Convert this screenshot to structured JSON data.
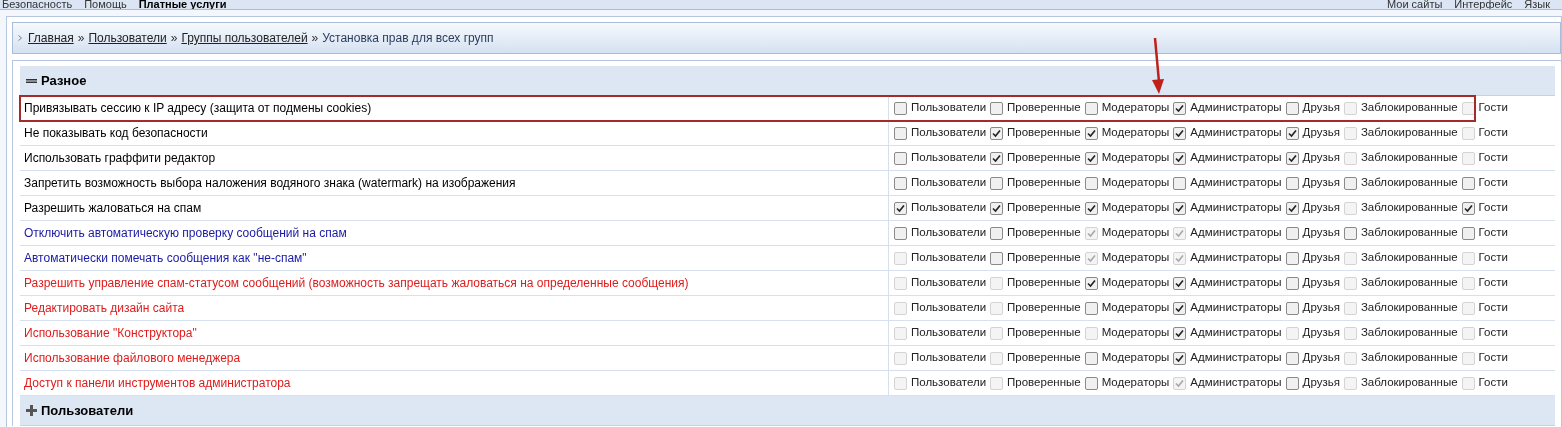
{
  "top_bar": {
    "left": [
      "Безопасность",
      "Помощь",
      "Платные услуги"
    ],
    "right": [
      "Мои сайты",
      "Интерфейс",
      "Язык"
    ]
  },
  "breadcrumbs": [
    {
      "label": "Главная",
      "link": true
    },
    {
      "separator": "»"
    },
    {
      "label": "Пользователи",
      "link": true
    },
    {
      "separator": "»"
    },
    {
      "label": "Группы пользователей",
      "link": true
    },
    {
      "separator": "»"
    },
    {
      "label": "Установка прав для всех групп",
      "link": false
    }
  ],
  "sections": [
    {
      "title": "Разное",
      "expanded": true,
      "rows": [
        {
          "label": "Привязывать сессию к IP адресу (защита от подмены cookies)",
          "color": "#000000",
          "highlighted": true,
          "groups": [
            {
              "label": "Пользователи",
              "checked": false,
              "disabled": false
            },
            {
              "label": "Проверенные",
              "checked": false,
              "disabled": false
            },
            {
              "label": "Модераторы",
              "checked": false,
              "disabled": false
            },
            {
              "label": "Администраторы",
              "checked": true,
              "disabled": false
            },
            {
              "label": "Друзья",
              "checked": false,
              "disabled": false
            },
            {
              "label": "Заблокированные",
              "checked": false,
              "disabled": true
            },
            {
              "label": "Гости",
              "checked": false,
              "disabled": true
            }
          ]
        },
        {
          "label": "Не показывать код безопасности",
          "color": "#000000",
          "highlighted": false,
          "groups": [
            {
              "label": "Пользователи",
              "checked": false,
              "disabled": false
            },
            {
              "label": "Проверенные",
              "checked": true,
              "disabled": false
            },
            {
              "label": "Модераторы",
              "checked": true,
              "disabled": false
            },
            {
              "label": "Администраторы",
              "checked": true,
              "disabled": false
            },
            {
              "label": "Друзья",
              "checked": true,
              "disabled": false
            },
            {
              "label": "Заблокированные",
              "checked": false,
              "disabled": true
            },
            {
              "label": "Гости",
              "checked": false,
              "disabled": true
            }
          ]
        },
        {
          "label": "Использовать граффити редактор",
          "color": "#000000",
          "highlighted": false,
          "groups": [
            {
              "label": "Пользователи",
              "checked": false,
              "disabled": false
            },
            {
              "label": "Проверенные",
              "checked": true,
              "disabled": false
            },
            {
              "label": "Модераторы",
              "checked": true,
              "disabled": false
            },
            {
              "label": "Администраторы",
              "checked": true,
              "disabled": false
            },
            {
              "label": "Друзья",
              "checked": true,
              "disabled": false
            },
            {
              "label": "Заблокированные",
              "checked": false,
              "disabled": true
            },
            {
              "label": "Гости",
              "checked": false,
              "disabled": true
            }
          ]
        },
        {
          "label": "Запретить возможность выбора наложения водяного знака (watermark) на изображения",
          "color": "#000000",
          "highlighted": false,
          "groups": [
            {
              "label": "Пользователи",
              "checked": false,
              "disabled": false
            },
            {
              "label": "Проверенные",
              "checked": false,
              "disabled": false
            },
            {
              "label": "Модераторы",
              "checked": false,
              "disabled": false
            },
            {
              "label": "Администраторы",
              "checked": false,
              "disabled": false
            },
            {
              "label": "Друзья",
              "checked": false,
              "disabled": false
            },
            {
              "label": "Заблокированные",
              "checked": false,
              "disabled": false
            },
            {
              "label": "Гости",
              "checked": false,
              "disabled": false
            }
          ]
        },
        {
          "label": "Разрешить жаловаться на спам",
          "color": "#000000",
          "highlighted": false,
          "groups": [
            {
              "label": "Пользователи",
              "checked": true,
              "disabled": false
            },
            {
              "label": "Проверенные",
              "checked": true,
              "disabled": false
            },
            {
              "label": "Модераторы",
              "checked": true,
              "disabled": false
            },
            {
              "label": "Администраторы",
              "checked": true,
              "disabled": false
            },
            {
              "label": "Друзья",
              "checked": true,
              "disabled": false
            },
            {
              "label": "Заблокированные",
              "checked": false,
              "disabled": true
            },
            {
              "label": "Гости",
              "checked": true,
              "disabled": false
            }
          ]
        },
        {
          "label": "Отключить автоматическую проверку сообщений на спам",
          "color": "#1a1aa6",
          "highlighted": false,
          "groups": [
            {
              "label": "Пользователи",
              "checked": false,
              "disabled": false
            },
            {
              "label": "Проверенные",
              "checked": false,
              "disabled": false
            },
            {
              "label": "Модераторы",
              "checked": true,
              "disabled": true
            },
            {
              "label": "Администраторы",
              "checked": true,
              "disabled": true
            },
            {
              "label": "Друзья",
              "checked": false,
              "disabled": false
            },
            {
              "label": "Заблокированные",
              "checked": false,
              "disabled": false
            },
            {
              "label": "Гости",
              "checked": false,
              "disabled": false
            }
          ]
        },
        {
          "label": "Автоматически помечать сообщения как \"не-спам\"",
          "color": "#1a1aa6",
          "highlighted": false,
          "groups": [
            {
              "label": "Пользователи",
              "checked": false,
              "disabled": true
            },
            {
              "label": "Проверенные",
              "checked": false,
              "disabled": false
            },
            {
              "label": "Модераторы",
              "checked": true,
              "disabled": true
            },
            {
              "label": "Администраторы",
              "checked": true,
              "disabled": true
            },
            {
              "label": "Друзья",
              "checked": false,
              "disabled": false
            },
            {
              "label": "Заблокированные",
              "checked": false,
              "disabled": true
            },
            {
              "label": "Гости",
              "checked": false,
              "disabled": true
            }
          ]
        },
        {
          "label": "Разрешить управление спам-статусом сообщений (возможность запрещать жаловаться на определенные сообщения)",
          "color": "#e01b1b",
          "highlighted": false,
          "groups": [
            {
              "label": "Пользователи",
              "checked": false,
              "disabled": true
            },
            {
              "label": "Проверенные",
              "checked": false,
              "disabled": true
            },
            {
              "label": "Модераторы",
              "checked": true,
              "disabled": false
            },
            {
              "label": "Администраторы",
              "checked": true,
              "disabled": false
            },
            {
              "label": "Друзья",
              "checked": false,
              "disabled": false
            },
            {
              "label": "Заблокированные",
              "checked": false,
              "disabled": true
            },
            {
              "label": "Гости",
              "checked": false,
              "disabled": true
            }
          ]
        },
        {
          "label": "Редактировать дизайн сайта",
          "color": "#e01b1b",
          "highlighted": false,
          "groups": [
            {
              "label": "Пользователи",
              "checked": false,
              "disabled": true
            },
            {
              "label": "Проверенные",
              "checked": false,
              "disabled": true
            },
            {
              "label": "Модераторы",
              "checked": false,
              "disabled": false
            },
            {
              "label": "Администраторы",
              "checked": true,
              "disabled": false
            },
            {
              "label": "Друзья",
              "checked": false,
              "disabled": false
            },
            {
              "label": "Заблокированные",
              "checked": false,
              "disabled": true
            },
            {
              "label": "Гости",
              "checked": false,
              "disabled": true
            }
          ]
        },
        {
          "label": "Использование \"Конструктора\"",
          "color": "#e01b1b",
          "highlighted": false,
          "groups": [
            {
              "label": "Пользователи",
              "checked": false,
              "disabled": true
            },
            {
              "label": "Проверенные",
              "checked": false,
              "disabled": true
            },
            {
              "label": "Модераторы",
              "checked": false,
              "disabled": true
            },
            {
              "label": "Администраторы",
              "checked": true,
              "disabled": false
            },
            {
              "label": "Друзья",
              "checked": false,
              "disabled": true
            },
            {
              "label": "Заблокированные",
              "checked": false,
              "disabled": true
            },
            {
              "label": "Гости",
              "checked": false,
              "disabled": true
            }
          ]
        },
        {
          "label": "Использование файлового менеджера",
          "color": "#e01b1b",
          "highlighted": false,
          "groups": [
            {
              "label": "Пользователи",
              "checked": false,
              "disabled": true
            },
            {
              "label": "Проверенные",
              "checked": false,
              "disabled": true
            },
            {
              "label": "Модераторы",
              "checked": false,
              "disabled": false
            },
            {
              "label": "Администраторы",
              "checked": true,
              "disabled": false
            },
            {
              "label": "Друзья",
              "checked": false,
              "disabled": false
            },
            {
              "label": "Заблокированные",
              "checked": false,
              "disabled": true
            },
            {
              "label": "Гости",
              "checked": false,
              "disabled": true
            }
          ]
        },
        {
          "label": "Доступ к панели инструментов администратора",
          "color": "#e01b1b",
          "highlighted": false,
          "groups": [
            {
              "label": "Пользователи",
              "checked": false,
              "disabled": true
            },
            {
              "label": "Проверенные",
              "checked": false,
              "disabled": true
            },
            {
              "label": "Модераторы",
              "checked": false,
              "disabled": false
            },
            {
              "label": "Администраторы",
              "checked": true,
              "disabled": true
            },
            {
              "label": "Друзья",
              "checked": false,
              "disabled": false
            },
            {
              "label": "Заблокированные",
              "checked": false,
              "disabled": true
            },
            {
              "label": "Гости",
              "checked": false,
              "disabled": true
            }
          ]
        }
      ]
    },
    {
      "title": "Пользователи",
      "expanded": false
    }
  ]
}
